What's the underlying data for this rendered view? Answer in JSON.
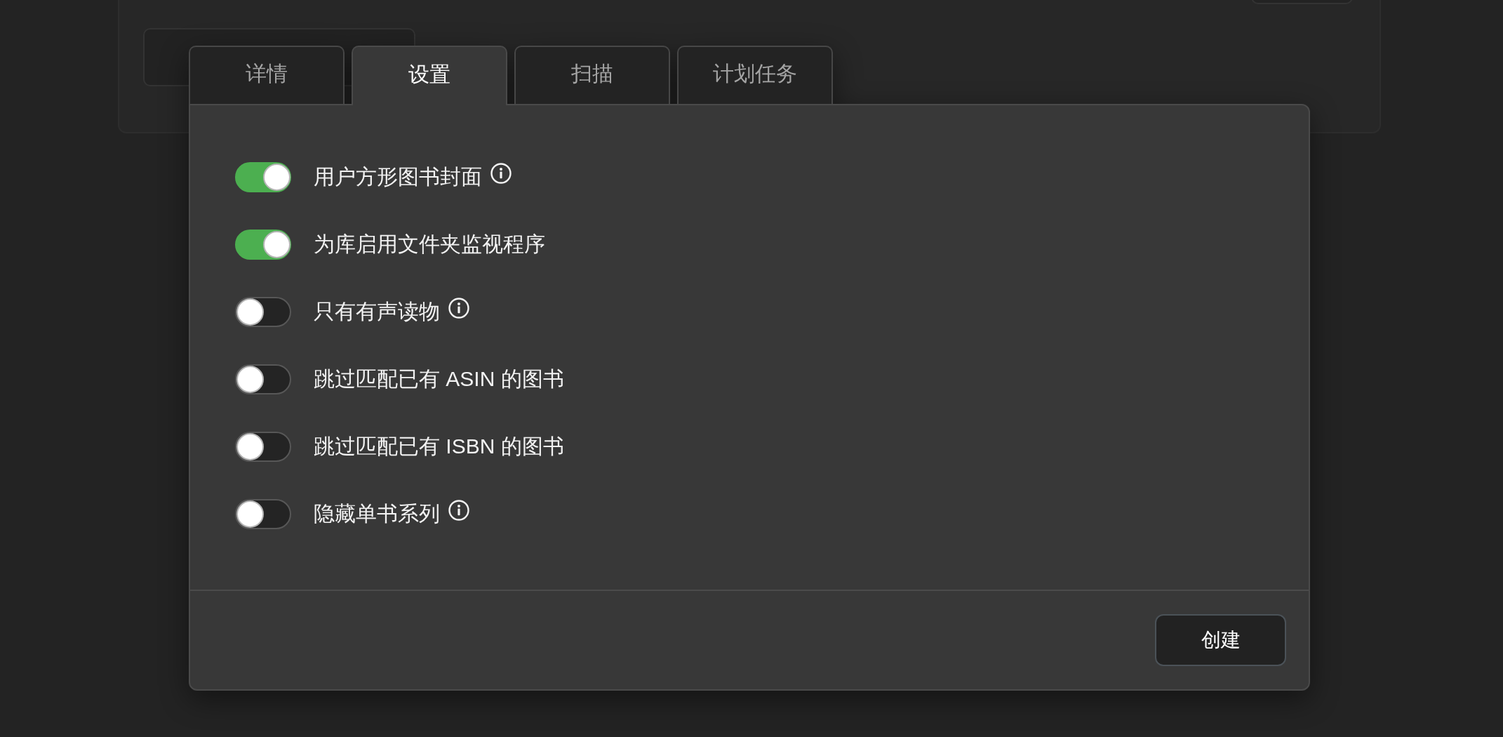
{
  "tabs": [
    {
      "label": "详情",
      "selected": false
    },
    {
      "label": "设置",
      "selected": true
    },
    {
      "label": "扫描",
      "selected": false
    },
    {
      "label": "计划任务",
      "selected": false
    }
  ],
  "settings": [
    {
      "label": "用户方形图书封面",
      "on": true,
      "info": true
    },
    {
      "label": "为库启用文件夹监视程序",
      "on": true,
      "info": false
    },
    {
      "label": "只有有声读物",
      "on": false,
      "info": true
    },
    {
      "label": "跳过匹配已有 ASIN 的图书",
      "on": false,
      "info": false
    },
    {
      "label": "跳过匹配已有 ISBN 的图书",
      "on": false,
      "info": false
    },
    {
      "label": "隐藏单书系列",
      "on": false,
      "info": true
    }
  ],
  "footer": {
    "buttons": [
      "创建"
    ]
  }
}
